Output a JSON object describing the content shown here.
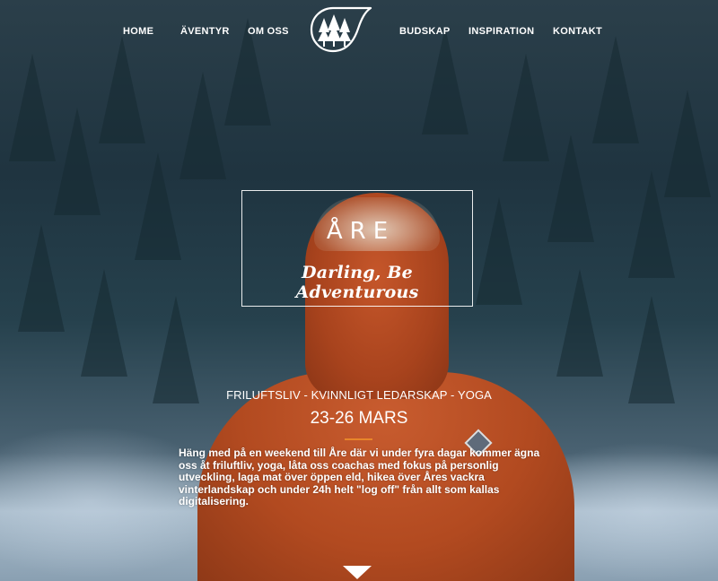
{
  "nav": {
    "items": [
      {
        "label": "HOME"
      },
      {
        "label": "ÄVENTYR"
      },
      {
        "label": "OM OSS"
      },
      {
        "label": "BUDSKAP"
      },
      {
        "label": "INSPIRATION"
      },
      {
        "label": "KONTAKT"
      }
    ],
    "logo_icon": "pine-trees-leaf-logo-icon"
  },
  "hero": {
    "title": "ÅRE",
    "tagline": "Darling, Be Adventurous",
    "subtitle": "FRILUFTSLIV - KVINNLIGT LEDARSKAP - YOGA",
    "dates": "23-26 MARS",
    "description": "Häng med på en weekend till Åre där vi under fyra dagar kommer ägna oss åt friluftliv, yoga, låta oss coachas med fokus på personlig utveckling, laga mat över öppen eld, hikea över Åres vackra vinterlandskap och under 24h helt \"log off\" från allt som kallas digitalisering.",
    "scroll_icon": "chevron-down-icon"
  },
  "colors": {
    "accent": "#e8862a",
    "text": "#ffffff",
    "jacket": "#b24a20"
  }
}
